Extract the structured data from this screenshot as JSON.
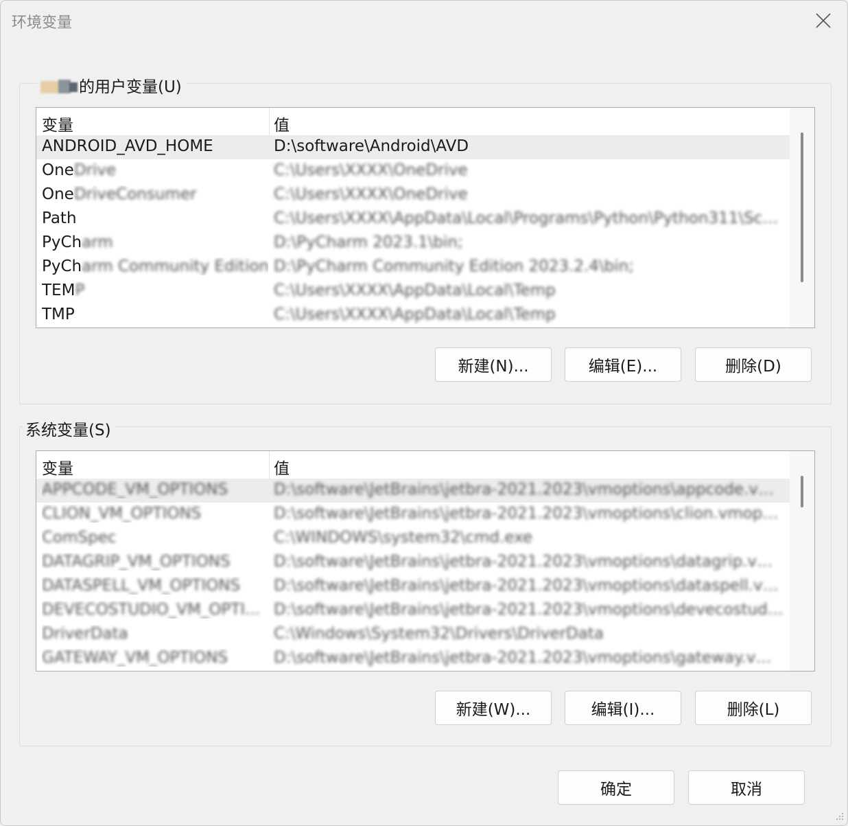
{
  "window": {
    "title": "环境变量"
  },
  "user_vars": {
    "group_label": "的用户变量(U)",
    "columns": {
      "name": "变量",
      "value": "值"
    },
    "rows": [
      {
        "name_visible": "ANDROID_AVD_HOME",
        "name_blurred": "",
        "value": "D:\\software\\Android\\AVD",
        "value_blurred": false,
        "selected": true
      },
      {
        "name_visible": "One",
        "name_blurred": "Drive",
        "value": "C:\\Users\\XXXX\\OneDrive",
        "value_blurred": true,
        "selected": false
      },
      {
        "name_visible": "One",
        "name_blurred": "DriveConsumer",
        "value": "C:\\Users\\XXXX\\OneDrive",
        "value_blurred": true,
        "selected": false
      },
      {
        "name_visible": "Path",
        "name_blurred": "",
        "value": "C:\\Users\\XXXX\\AppData\\Local\\Programs\\Python\\Python311\\Scripts...",
        "value_blurred": true,
        "selected": false
      },
      {
        "name_visible": "PyCh",
        "name_blurred": "arm",
        "value": "D:\\PyCharm 2023.1\\bin;",
        "value_blurred": true,
        "selected": false
      },
      {
        "name_visible": "PyCh",
        "name_blurred": "arm Community Edition",
        "value": "D:\\PyCharm Community Edition 2023.2.4\\bin;",
        "value_blurred": true,
        "selected": false
      },
      {
        "name_visible": "TEM",
        "name_blurred": "P",
        "value": "C:\\Users\\XXXX\\AppData\\Local\\Temp",
        "value_blurred": true,
        "selected": false
      },
      {
        "name_visible": "TMP",
        "name_blurred": "",
        "value": "C:\\Users\\XXXX\\AppData\\Local\\Temp",
        "value_blurred": true,
        "selected": false
      }
    ],
    "buttons": {
      "new": "新建(N)...",
      "edit": "编辑(E)...",
      "delete": "删除(D)"
    }
  },
  "system_vars": {
    "group_label": "系统变量(S)",
    "columns": {
      "name": "变量",
      "value": "值"
    },
    "rows": [
      {
        "name_visible": "",
        "name_blurred": "APPCODE_VM_OPTIONS",
        "value": "D:\\software\\JetBrains\\jetbra-2021.2023\\vmoptions\\appcode.vmop...",
        "value_blurred": true,
        "selected": true
      },
      {
        "name_visible": "",
        "name_blurred": "CLION_VM_OPTIONS",
        "value": "D:\\software\\JetBrains\\jetbra-2021.2023\\vmoptions\\clion.vmoptions",
        "value_blurred": true,
        "selected": false
      },
      {
        "name_visible": "",
        "name_blurred": "ComSpec",
        "value": "C:\\WINDOWS\\system32\\cmd.exe",
        "value_blurred": true,
        "selected": false
      },
      {
        "name_visible": "",
        "name_blurred": "DATAGRIP_VM_OPTIONS",
        "value": "D:\\software\\JetBrains\\jetbra-2021.2023\\vmoptions\\datagrip.vmop...",
        "value_blurred": true,
        "selected": false
      },
      {
        "name_visible": "",
        "name_blurred": "DATASPELL_VM_OPTIONS",
        "value": "D:\\software\\JetBrains\\jetbra-2021.2023\\vmoptions\\dataspell.vmo...",
        "value_blurred": true,
        "selected": false
      },
      {
        "name_visible": "",
        "name_blurred": "DEVECOSTUDIO_VM_OPTI...",
        "value": "D:\\software\\JetBrains\\jetbra-2021.2023\\vmoptions\\devecostudio...",
        "value_blurred": true,
        "selected": false
      },
      {
        "name_visible": "",
        "name_blurred": "DriverData",
        "value": "C:\\Windows\\System32\\Drivers\\DriverData",
        "value_blurred": true,
        "selected": false
      },
      {
        "name_visible": "",
        "name_blurred": "GATEWAY_VM_OPTIONS",
        "value": "D:\\software\\JetBrains\\jetbra-2021.2023\\vmoptions\\gateway.vmop...",
        "value_blurred": true,
        "selected": false
      }
    ],
    "buttons": {
      "new": "新建(W)...",
      "edit": "编辑(I)...",
      "delete": "删除(L)"
    }
  },
  "footer": {
    "ok": "确定",
    "cancel": "取消"
  },
  "icons": {
    "close": "close-icon",
    "user": "user-avatar-icon",
    "resize": "resize-grip-icon"
  }
}
